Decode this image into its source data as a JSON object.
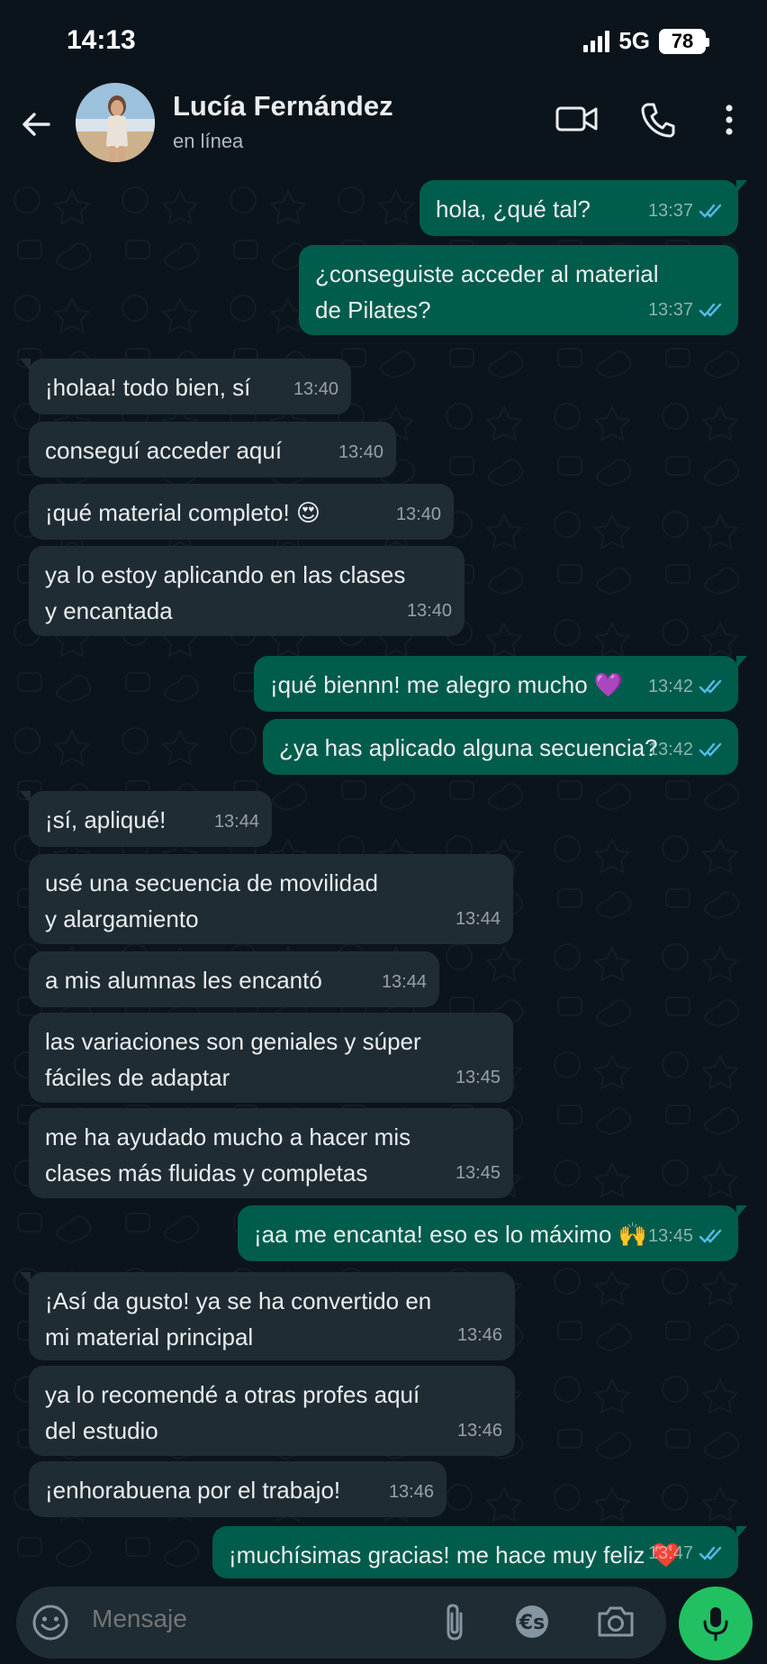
{
  "status_bar": {
    "time": "14:13",
    "network": "5G",
    "battery": "78"
  },
  "header": {
    "contact_name": "Lucía Fernández",
    "contact_status": "en línea"
  },
  "messages": [
    {
      "dir": "out",
      "text": "hola, ¿qué tal?",
      "time": "13:37"
    },
    {
      "dir": "out",
      "text": "¿conseguiste acceder al material\nde Pilates?",
      "time": "13:37"
    },
    {
      "dir": "in",
      "text": "¡holaa! todo bien, sí",
      "time": "13:40"
    },
    {
      "dir": "in",
      "text": "conseguí acceder aquí",
      "time": "13:40"
    },
    {
      "dir": "in",
      "text": "¡qué material completo! 😍",
      "time": "13:40"
    },
    {
      "dir": "in",
      "text": "ya lo estoy aplicando en las clases\ny encantada",
      "time": "13:40"
    },
    {
      "dir": "out",
      "text": "¡qué biennn! me alegro mucho 💜",
      "time": "13:42"
    },
    {
      "dir": "out",
      "text": "¿ya has aplicado alguna secuencia?",
      "time": "13:42"
    },
    {
      "dir": "in",
      "text": "¡sí, apliqué!",
      "time": "13:44"
    },
    {
      "dir": "in",
      "text": "usé una secuencia de movilidad\ny alargamiento",
      "time": "13:44"
    },
    {
      "dir": "in",
      "text": "a mis alumnas les encantó",
      "time": "13:44"
    },
    {
      "dir": "in",
      "text": "las variaciones son geniales y súper\nfáciles de adaptar",
      "time": "13:45"
    },
    {
      "dir": "in",
      "text": "me ha ayudado mucho a hacer mis\nclases más fluidas y completas",
      "time": "13:45"
    },
    {
      "dir": "out",
      "text": "¡aa me encanta! eso es lo máximo 🙌",
      "time": "13:45"
    },
    {
      "dir": "in",
      "text": "¡Así da gusto! ya se ha convertido en\nmi material principal",
      "time": "13:46"
    },
    {
      "dir": "in",
      "text": "ya lo recomendé a otras profes aquí\ndel estudio",
      "time": "13:46"
    },
    {
      "dir": "in",
      "text": "¡enhorabuena por el trabajo!",
      "time": "13:46"
    },
    {
      "dir": "out",
      "text": "¡muchísimas gracias! me hace muy feliz ❤️",
      "time": "13:47"
    }
  ],
  "composer": {
    "placeholder": "Mensaje"
  },
  "colors": {
    "incoming": "#202c33",
    "outgoing": "#005c4b",
    "read_tick": "#53bdeb",
    "mic": "#21c063"
  }
}
